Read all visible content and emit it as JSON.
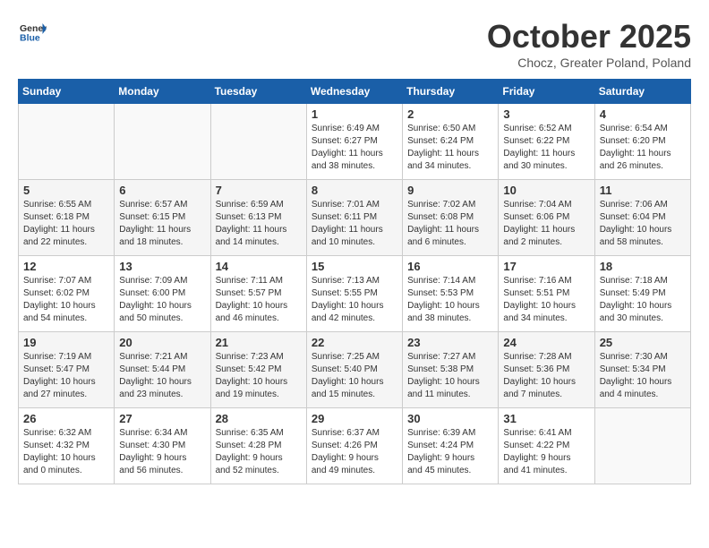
{
  "header": {
    "logo_general": "General",
    "logo_blue": "Blue",
    "month_title": "October 2025",
    "subtitle": "Chocz, Greater Poland, Poland"
  },
  "days_of_week": [
    "Sunday",
    "Monday",
    "Tuesday",
    "Wednesday",
    "Thursday",
    "Friday",
    "Saturday"
  ],
  "weeks": [
    [
      {
        "day": "",
        "info": ""
      },
      {
        "day": "",
        "info": ""
      },
      {
        "day": "",
        "info": ""
      },
      {
        "day": "1",
        "info": "Sunrise: 6:49 AM\nSunset: 6:27 PM\nDaylight: 11 hours\nand 38 minutes."
      },
      {
        "day": "2",
        "info": "Sunrise: 6:50 AM\nSunset: 6:24 PM\nDaylight: 11 hours\nand 34 minutes."
      },
      {
        "day": "3",
        "info": "Sunrise: 6:52 AM\nSunset: 6:22 PM\nDaylight: 11 hours\nand 30 minutes."
      },
      {
        "day": "4",
        "info": "Sunrise: 6:54 AM\nSunset: 6:20 PM\nDaylight: 11 hours\nand 26 minutes."
      }
    ],
    [
      {
        "day": "5",
        "info": "Sunrise: 6:55 AM\nSunset: 6:18 PM\nDaylight: 11 hours\nand 22 minutes."
      },
      {
        "day": "6",
        "info": "Sunrise: 6:57 AM\nSunset: 6:15 PM\nDaylight: 11 hours\nand 18 minutes."
      },
      {
        "day": "7",
        "info": "Sunrise: 6:59 AM\nSunset: 6:13 PM\nDaylight: 11 hours\nand 14 minutes."
      },
      {
        "day": "8",
        "info": "Sunrise: 7:01 AM\nSunset: 6:11 PM\nDaylight: 11 hours\nand 10 minutes."
      },
      {
        "day": "9",
        "info": "Sunrise: 7:02 AM\nSunset: 6:08 PM\nDaylight: 11 hours\nand 6 minutes."
      },
      {
        "day": "10",
        "info": "Sunrise: 7:04 AM\nSunset: 6:06 PM\nDaylight: 11 hours\nand 2 minutes."
      },
      {
        "day": "11",
        "info": "Sunrise: 7:06 AM\nSunset: 6:04 PM\nDaylight: 10 hours\nand 58 minutes."
      }
    ],
    [
      {
        "day": "12",
        "info": "Sunrise: 7:07 AM\nSunset: 6:02 PM\nDaylight: 10 hours\nand 54 minutes."
      },
      {
        "day": "13",
        "info": "Sunrise: 7:09 AM\nSunset: 6:00 PM\nDaylight: 10 hours\nand 50 minutes."
      },
      {
        "day": "14",
        "info": "Sunrise: 7:11 AM\nSunset: 5:57 PM\nDaylight: 10 hours\nand 46 minutes."
      },
      {
        "day": "15",
        "info": "Sunrise: 7:13 AM\nSunset: 5:55 PM\nDaylight: 10 hours\nand 42 minutes."
      },
      {
        "day": "16",
        "info": "Sunrise: 7:14 AM\nSunset: 5:53 PM\nDaylight: 10 hours\nand 38 minutes."
      },
      {
        "day": "17",
        "info": "Sunrise: 7:16 AM\nSunset: 5:51 PM\nDaylight: 10 hours\nand 34 minutes."
      },
      {
        "day": "18",
        "info": "Sunrise: 7:18 AM\nSunset: 5:49 PM\nDaylight: 10 hours\nand 30 minutes."
      }
    ],
    [
      {
        "day": "19",
        "info": "Sunrise: 7:19 AM\nSunset: 5:47 PM\nDaylight: 10 hours\nand 27 minutes."
      },
      {
        "day": "20",
        "info": "Sunrise: 7:21 AM\nSunset: 5:44 PM\nDaylight: 10 hours\nand 23 minutes."
      },
      {
        "day": "21",
        "info": "Sunrise: 7:23 AM\nSunset: 5:42 PM\nDaylight: 10 hours\nand 19 minutes."
      },
      {
        "day": "22",
        "info": "Sunrise: 7:25 AM\nSunset: 5:40 PM\nDaylight: 10 hours\nand 15 minutes."
      },
      {
        "day": "23",
        "info": "Sunrise: 7:27 AM\nSunset: 5:38 PM\nDaylight: 10 hours\nand 11 minutes."
      },
      {
        "day": "24",
        "info": "Sunrise: 7:28 AM\nSunset: 5:36 PM\nDaylight: 10 hours\nand 7 minutes."
      },
      {
        "day": "25",
        "info": "Sunrise: 7:30 AM\nSunset: 5:34 PM\nDaylight: 10 hours\nand 4 minutes."
      }
    ],
    [
      {
        "day": "26",
        "info": "Sunrise: 6:32 AM\nSunset: 4:32 PM\nDaylight: 10 hours\nand 0 minutes."
      },
      {
        "day": "27",
        "info": "Sunrise: 6:34 AM\nSunset: 4:30 PM\nDaylight: 9 hours\nand 56 minutes."
      },
      {
        "day": "28",
        "info": "Sunrise: 6:35 AM\nSunset: 4:28 PM\nDaylight: 9 hours\nand 52 minutes."
      },
      {
        "day": "29",
        "info": "Sunrise: 6:37 AM\nSunset: 4:26 PM\nDaylight: 9 hours\nand 49 minutes."
      },
      {
        "day": "30",
        "info": "Sunrise: 6:39 AM\nSunset: 4:24 PM\nDaylight: 9 hours\nand 45 minutes."
      },
      {
        "day": "31",
        "info": "Sunrise: 6:41 AM\nSunset: 4:22 PM\nDaylight: 9 hours\nand 41 minutes."
      },
      {
        "day": "",
        "info": ""
      }
    ]
  ]
}
